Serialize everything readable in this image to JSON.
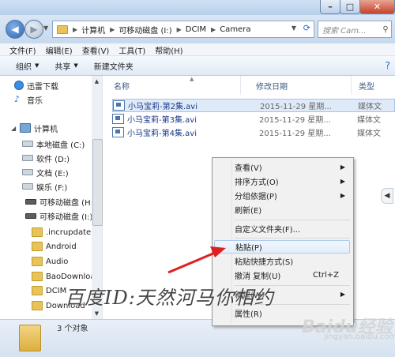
{
  "window": {
    "controls": {
      "minimize": "–",
      "maximize": "□",
      "close": "✕"
    }
  },
  "address": {
    "crumbs": [
      "计算机",
      "可移动磁盘 (I:)",
      "DCIM",
      "Camera"
    ],
    "search_placeholder": "搜索 Cam..."
  },
  "menubar": {
    "items": [
      "文件(F)",
      "编辑(E)",
      "查看(V)",
      "工具(T)",
      "帮助(H)"
    ]
  },
  "toolbar": {
    "organize": "组织",
    "share": "共享",
    "new_folder": "新建文件夹"
  },
  "navpane": {
    "items": [
      {
        "label": "迅雷下载",
        "icon": "thunder-icon"
      },
      {
        "label": "音乐",
        "icon": "music-icon"
      },
      {
        "label": "计算机",
        "icon": "computer-icon"
      },
      {
        "label": "本地磁盘 (C:)",
        "icon": "drive-icon"
      },
      {
        "label": "软件 (D:)",
        "icon": "drive-icon"
      },
      {
        "label": "文档 (E:)",
        "icon": "drive-icon"
      },
      {
        "label": "娱乐 (F:)",
        "icon": "drive-icon"
      },
      {
        "label": "可移动磁盘 (H:)",
        "icon": "usb-drive-icon"
      },
      {
        "label": "可移动磁盘 (I:)",
        "icon": "usb-drive-icon"
      },
      {
        "label": ".incrupdate",
        "icon": "folder-icon"
      },
      {
        "label": "Android",
        "icon": "folder-icon"
      },
      {
        "label": "Audio",
        "icon": "folder-icon"
      },
      {
        "label": "BaoDownload",
        "icon": "folder-icon"
      },
      {
        "label": "DCIM",
        "icon": "folder-icon"
      },
      {
        "label": "Download",
        "icon": "folder-icon"
      }
    ]
  },
  "filelist": {
    "columns": {
      "name": "名称",
      "date": "修改日期",
      "type": "类型"
    },
    "rows": [
      {
        "name": "小马宝莉-第2集.avi",
        "date": "2015-11-29 星期...",
        "type": "媒体文"
      },
      {
        "name": "小马宝莉-第3集.avi",
        "date": "2015-11-29 星期...",
        "type": "媒体文"
      },
      {
        "name": "小马宝莉-第4集.avi",
        "date": "2015-11-29 星期...",
        "type": "媒体文"
      }
    ]
  },
  "context_menu": {
    "items": [
      {
        "label": "查看(V)",
        "submenu": true
      },
      {
        "label": "排序方式(O)",
        "submenu": true
      },
      {
        "label": "分组依据(P)",
        "submenu": true
      },
      {
        "label": "刷新(E)"
      },
      {
        "label": "自定义文件夹(F)..."
      },
      {
        "label": "粘贴(P)",
        "highlighted": true
      },
      {
        "label": "粘贴快捷方式(S)"
      },
      {
        "label": "撤消 复制(U)",
        "shortcut": "Ctrl+Z"
      },
      {
        "label": "新建(W)",
        "submenu": true
      },
      {
        "label": "属性(R)"
      }
    ]
  },
  "status": {
    "text": "3 个对象"
  },
  "watermark": {
    "text": "百度ID:天然河马你相约",
    "logo": "Baidu经验",
    "sub": "jingyan.baidu.com"
  },
  "colors": {
    "accent": "#2a6ad0",
    "annotation_arrow": "#e02020",
    "highlight": "#e3eefb"
  }
}
